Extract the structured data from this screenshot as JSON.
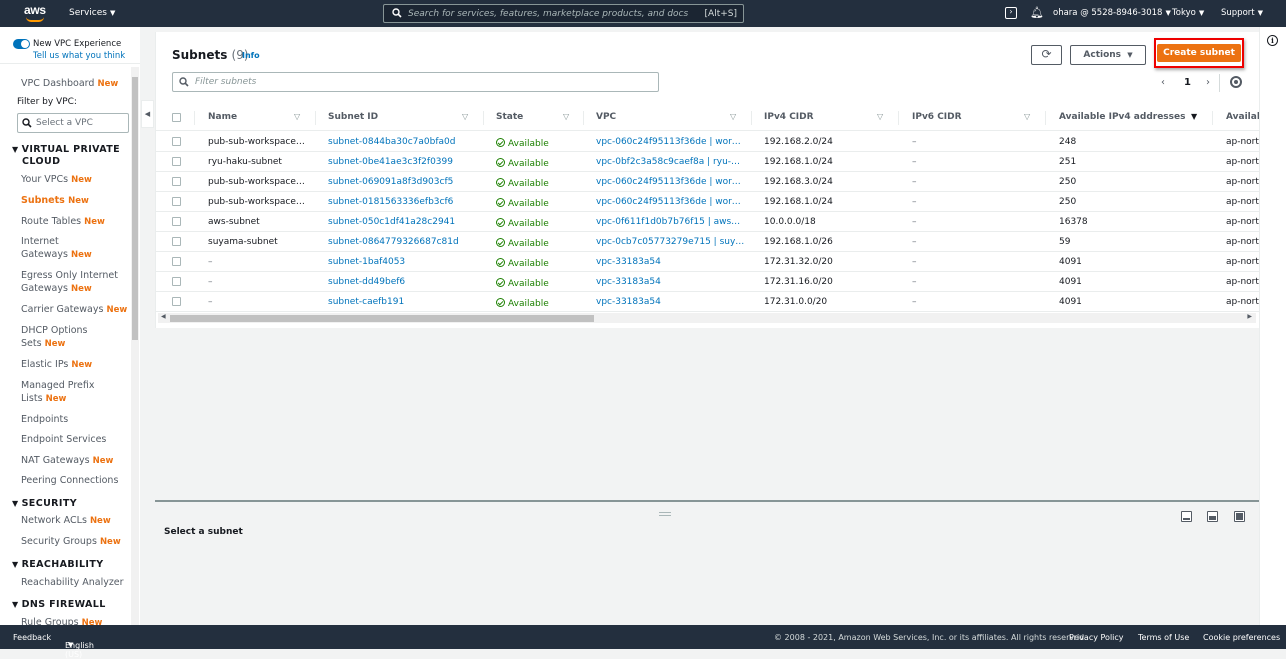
{
  "topnav": {
    "logo": "aws",
    "services_label": "Services",
    "search_placeholder": "Search for services, features, marketplace products, and docs",
    "search_shortcut": "[Alt+S]",
    "account": "ohara @ 5528-8946-3018",
    "region": "Tokyo",
    "support": "Support",
    "icons": [
      "cloudshell-icon",
      "bell-icon"
    ]
  },
  "sidebar": {
    "toggle_label": "New VPC Experience",
    "toggle_link": "Tell us what you think",
    "dashboard": {
      "label": "VPC Dashboard",
      "badge": "New"
    },
    "filter_label": "Filter by VPC:",
    "filter_placeholder": "Select a VPC",
    "badge_new": "New",
    "sections": [
      {
        "title_line1": "VIRTUAL PRIVATE",
        "title_line2": "CLOUD",
        "items": [
          {
            "label": "Your VPCs",
            "badge": "New"
          },
          {
            "label": "Subnets",
            "badge": "New",
            "active": true
          },
          {
            "label": "Route Tables",
            "badge": "New"
          },
          {
            "label_line1": "Internet",
            "label_line2": "Gateways",
            "badge": "New"
          },
          {
            "label_line1": "Egress Only Internet",
            "label_line2": "Gateways",
            "badge": "New"
          },
          {
            "label": "Carrier Gateways",
            "badge": "New"
          },
          {
            "label_line1": "DHCP Options",
            "label_line2": "Sets",
            "badge": "New"
          },
          {
            "label": "Elastic IPs",
            "badge": "New"
          },
          {
            "label_line1": "Managed Prefix",
            "label_line2": "Lists",
            "badge": "New"
          },
          {
            "label": "Endpoints"
          },
          {
            "label": "Endpoint Services"
          },
          {
            "label": "NAT Gateways",
            "badge": "New"
          },
          {
            "label": "Peering Connections"
          }
        ]
      },
      {
        "title": "SECURITY",
        "items": [
          {
            "label": "Network ACLs",
            "badge": "New"
          },
          {
            "label": "Security Groups",
            "badge": "New"
          }
        ]
      },
      {
        "title": "REACHABILITY",
        "items": [
          {
            "label": "Reachability Analyzer"
          }
        ]
      },
      {
        "title": "DNS FIREWALL",
        "items": [
          {
            "label": "Rule Groups",
            "badge": "New"
          }
        ]
      }
    ]
  },
  "main": {
    "title": "Subnets",
    "count": "(9)",
    "info": "Info",
    "actions_label": "Actions",
    "create_label": "Create subnet",
    "filter_placeholder": "Filter subnets",
    "page": "1",
    "columns": [
      "Name",
      "Subnet ID",
      "State",
      "VPC",
      "IPv4 CIDR",
      "IPv6 CIDR",
      "Available IPv4 addresses",
      "Availab"
    ],
    "rows": [
      {
        "name": "pub-sub-workspace…",
        "id": "subnet-0844ba30c7a0bfa0d",
        "state": "Available",
        "vpc": "vpc-060c24f95113f36de | wor…",
        "ipv4": "192.168.2.0/24",
        "ipv6": "–",
        "avail": "248",
        "az": "ap-nort"
      },
      {
        "name": "ryu-haku-subnet",
        "id": "subnet-0be41ae3c3f2f0399",
        "state": "Available",
        "vpc": "vpc-0bf2c3a58c9caef8a | ryu-…",
        "ipv4": "192.168.1.0/24",
        "ipv6": "–",
        "avail": "251",
        "az": "ap-nort"
      },
      {
        "name": "pub-sub-workspace…",
        "id": "subnet-069091a8f3d903cf5",
        "state": "Available",
        "vpc": "vpc-060c24f95113f36de | wor…",
        "ipv4": "192.168.3.0/24",
        "ipv6": "–",
        "avail": "250",
        "az": "ap-nort"
      },
      {
        "name": "pub-sub-workspace…",
        "id": "subnet-0181563336efb3cf6",
        "state": "Available",
        "vpc": "vpc-060c24f95113f36de | wor…",
        "ipv4": "192.168.1.0/24",
        "ipv6": "–",
        "avail": "250",
        "az": "ap-nort"
      },
      {
        "name": "aws-subnet",
        "id": "subnet-050c1df41a28c2941",
        "state": "Available",
        "vpc": "vpc-0f611f1d0b7b76f15 | aws…",
        "ipv4": "10.0.0.0/18",
        "ipv6": "–",
        "avail": "16378",
        "az": "ap-nort"
      },
      {
        "name": "suyama-subnet",
        "id": "subnet-0864779326687c81d",
        "state": "Available",
        "vpc": "vpc-0cb7c05773279e715 | suy…",
        "ipv4": "192.168.1.0/26",
        "ipv6": "–",
        "avail": "59",
        "az": "ap-nort"
      },
      {
        "name": "–",
        "id": "subnet-1baf4053",
        "state": "Available",
        "vpc": "vpc-33183a54",
        "ipv4": "172.31.32.0/20",
        "ipv6": "–",
        "avail": "4091",
        "az": "ap-nort"
      },
      {
        "name": "–",
        "id": "subnet-dd49bef6",
        "state": "Available",
        "vpc": "vpc-33183a54",
        "ipv4": "172.31.16.0/20",
        "ipv6": "–",
        "avail": "4091",
        "az": "ap-nort"
      },
      {
        "name": "–",
        "id": "subnet-caefb191",
        "state": "Available",
        "vpc": "vpc-33183a54",
        "ipv4": "172.31.0.0/20",
        "ipv6": "–",
        "avail": "4091",
        "az": "ap-nort"
      }
    ]
  },
  "detail": {
    "empty_text": "Select a subnet"
  },
  "footer": {
    "feedback": "Feedback",
    "language": "English (US)",
    "copyright": "© 2008 - 2021, Amazon Web Services, Inc. or its affiliates. All rights reserved.",
    "privacy": "Privacy Policy",
    "terms": "Terms of Use",
    "cookies": "Cookie preferences"
  },
  "colors": {
    "accent": "#ec7211",
    "link": "#0073bb",
    "success": "#1d8102",
    "nav_bg": "#232f3e",
    "highlight_border": "#ee0000"
  }
}
